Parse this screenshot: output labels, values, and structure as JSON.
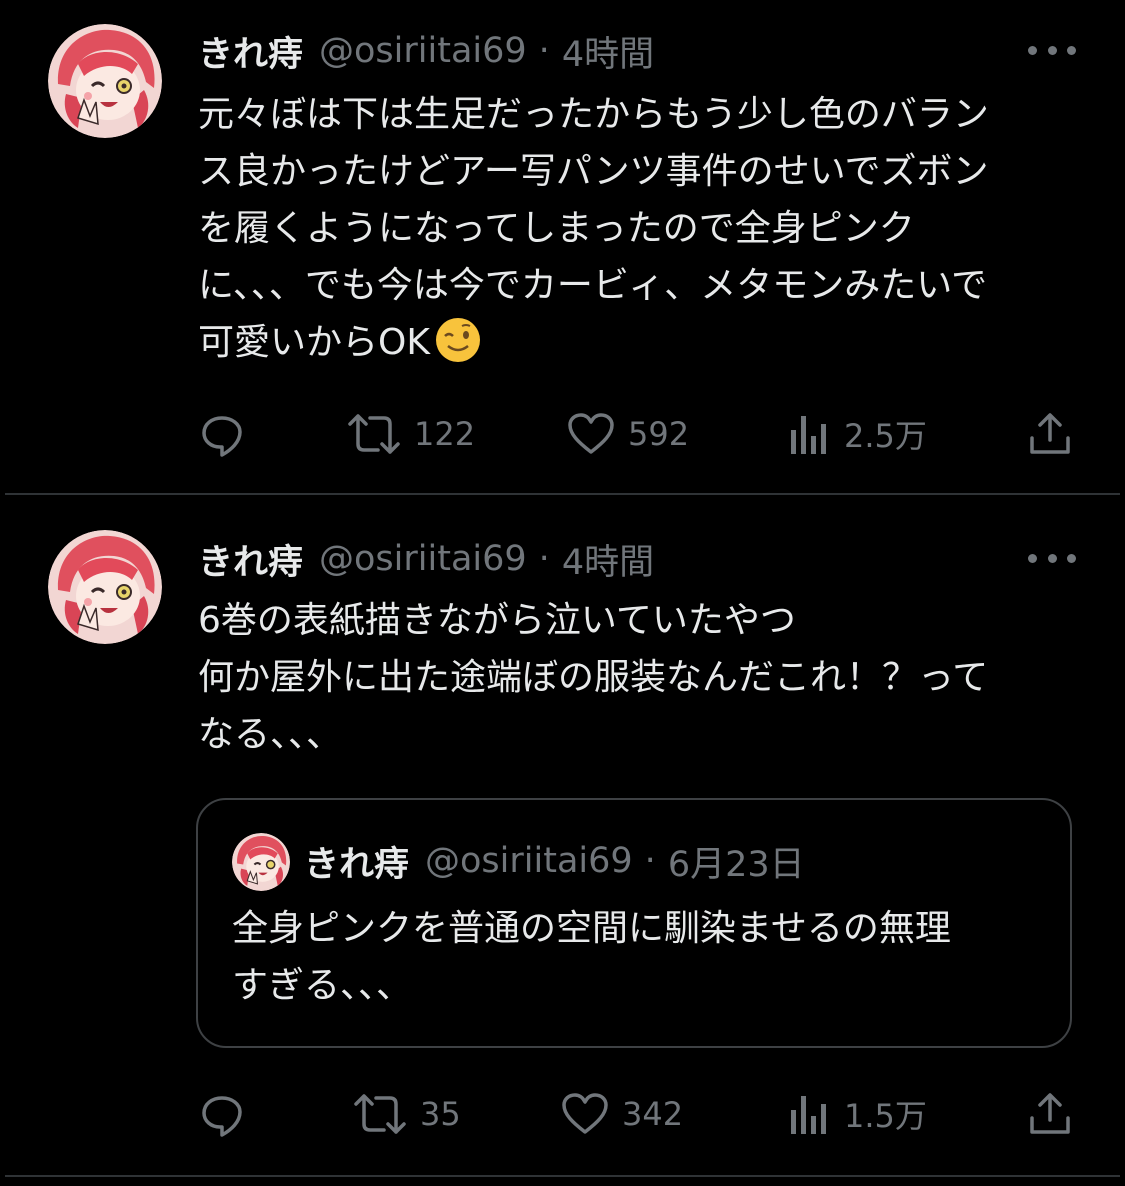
{
  "colors": {
    "background": "#000000",
    "text_primary": "#e7e9ea",
    "text_secondary": "#71767b",
    "divider": "#2f3336"
  },
  "tweets": [
    {
      "author_name": "きれ痔",
      "handle": "@osiriitai69",
      "separator": "·",
      "time": "4時間",
      "text_lines": [
        "元々ぼは下は生足だったからもう少し色のバラン",
        "ス良かったけどアー写パンツ事件のせいでズボン",
        "を履くようになってしまったので全身ピンク",
        "に、、、でも今は今でカービィ、メタモンみたいで",
        "可愛いからOK"
      ],
      "emoji": "winking-face",
      "replies_icon": "reply-icon",
      "retweets": "122",
      "likes": "592",
      "views": "2.5万",
      "share_icon": "share-icon"
    },
    {
      "author_name": "きれ痔",
      "handle": "@osiriitai69",
      "separator": "·",
      "time": "4時間",
      "text_lines": [
        "6巻の表紙描きながら泣いていたやつ",
        "何か屋外に出た途端ぼの服装なんだこれ！？って",
        "なる、、、"
      ],
      "quote": {
        "author_name": "きれ痔",
        "handle": "@osiriitai69",
        "separator": "·",
        "time": "6月23日",
        "text_lines": [
          "全身ピンクを普通の空間に馴染ませるの無理",
          "すぎる、、、"
        ]
      },
      "replies_icon": "reply-icon",
      "retweets": "35",
      "likes": "342",
      "views": "1.5万",
      "share_icon": "share-icon"
    }
  ]
}
